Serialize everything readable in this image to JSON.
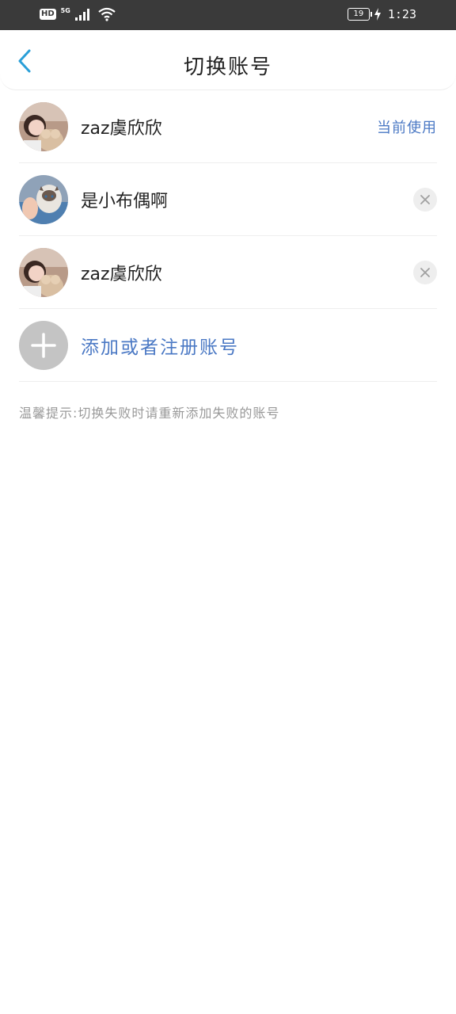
{
  "status_bar": {
    "hd": "HD",
    "network": "5G",
    "battery": "19",
    "time": "1:23"
  },
  "header": {
    "title": "切换账号",
    "back_icon": "chevron-left-icon"
  },
  "accounts": [
    {
      "name": "zaz虞欣欣",
      "current_label": "当前使用",
      "avatar": "girl-with-plush-avatar"
    },
    {
      "name": "是小布偶啊",
      "avatar": "cat-avatar",
      "action_icon": "close-icon"
    },
    {
      "name": "zaz虞欣欣",
      "avatar": "girl-with-plush-avatar",
      "action_icon": "close-icon"
    }
  ],
  "add_account": {
    "label": "添加或者注册账号",
    "icon": "plus-icon"
  },
  "tip": "温馨提示:切换失败时请重新添加失败的账号",
  "colors": {
    "accent": "#4a78c4",
    "status_bar": "#3a3a3a",
    "divider": "#eeeeee",
    "tip_text": "#999999"
  }
}
